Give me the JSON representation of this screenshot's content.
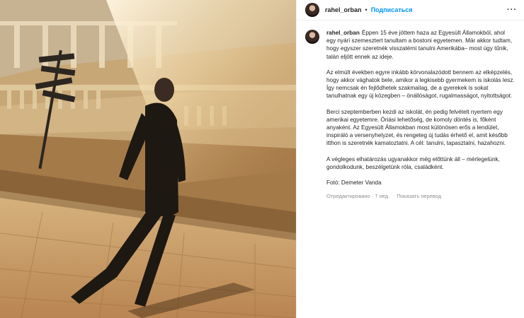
{
  "post": {
    "username": "rahel_orban",
    "separator": "•",
    "follow_label": "Подписаться",
    "more_icon_text": "···",
    "caption_username": "rahel_orban",
    "paragraphs": [
      "Éppen 15 éve jöttem haza az Egyesült Államokból, ahol egy nyári szemesztert tanultam a bostoni egyetemen. Már akkor tudtam, hogy egyszer szeretnék visszatérni tanulni Amerikába– most úgy tűnik, talán eljött ennek az ideje.",
      "Az elmúlt években egyre inkább körvonalazódott bennem az elképzelés, hogy akkor vághatok bele, amikor a legkisebb gyermekem is iskolás lesz. Így nemcsak én fejlődhetek szakmailag, de a gyerekek is sokat tanulhatnak egy új közegben – önállóságot, rugalmasságot, nyitottságot.",
      "Berci szeptemberben kezdi az iskolát, én pedig felvételt nyertem egy amerikai egyetemre. Óriási lehetőség, de komoly döntés is, főként anyaként. Az Egyesült Államokban most különösen erős a lendület, inspiráló a versenyhelyzet, és rengeteg új tudás érhető el, amit később itthon is szeretnék kamatoztatni. A cél: tanulni, tapasztalni, hazahozni.",
      "A végleges elhatározás ugyanakkor még előttünk áll – mérlegelünk, gondolkodunk, beszélgetünk róla, családként.",
      "Fotó: Demeter Vanda"
    ],
    "edited_time": "Отредактировано · 7 нед.",
    "translate_label": "Показать перевод"
  }
}
